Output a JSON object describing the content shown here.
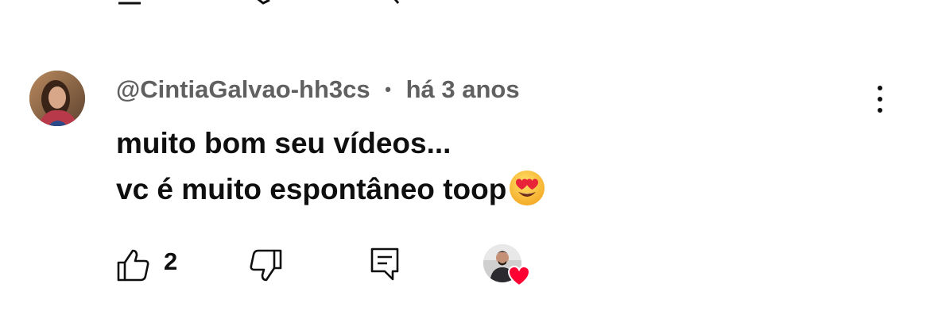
{
  "comment": {
    "author": "@CintiaGalvao-hh3cs",
    "separator": "•",
    "time": "há 3 anos",
    "lines": [
      "muito bom seu vídeos...",
      "vc é muito espontâneo toop"
    ],
    "emoji": "heart-eyes-emoji"
  },
  "actions": {
    "like_count": "2",
    "like_icon": "thumbs-up-icon",
    "dislike_icon": "thumbs-down-icon",
    "reply_icon": "reply-comment-icon",
    "creator_heart_icon": "heart-icon",
    "menu_icon": "more-vertical-icon"
  },
  "colors": {
    "text": "#0f0f0f",
    "secondary_text": "#606060",
    "heart": "#ff0033",
    "background": "#ffffff"
  }
}
